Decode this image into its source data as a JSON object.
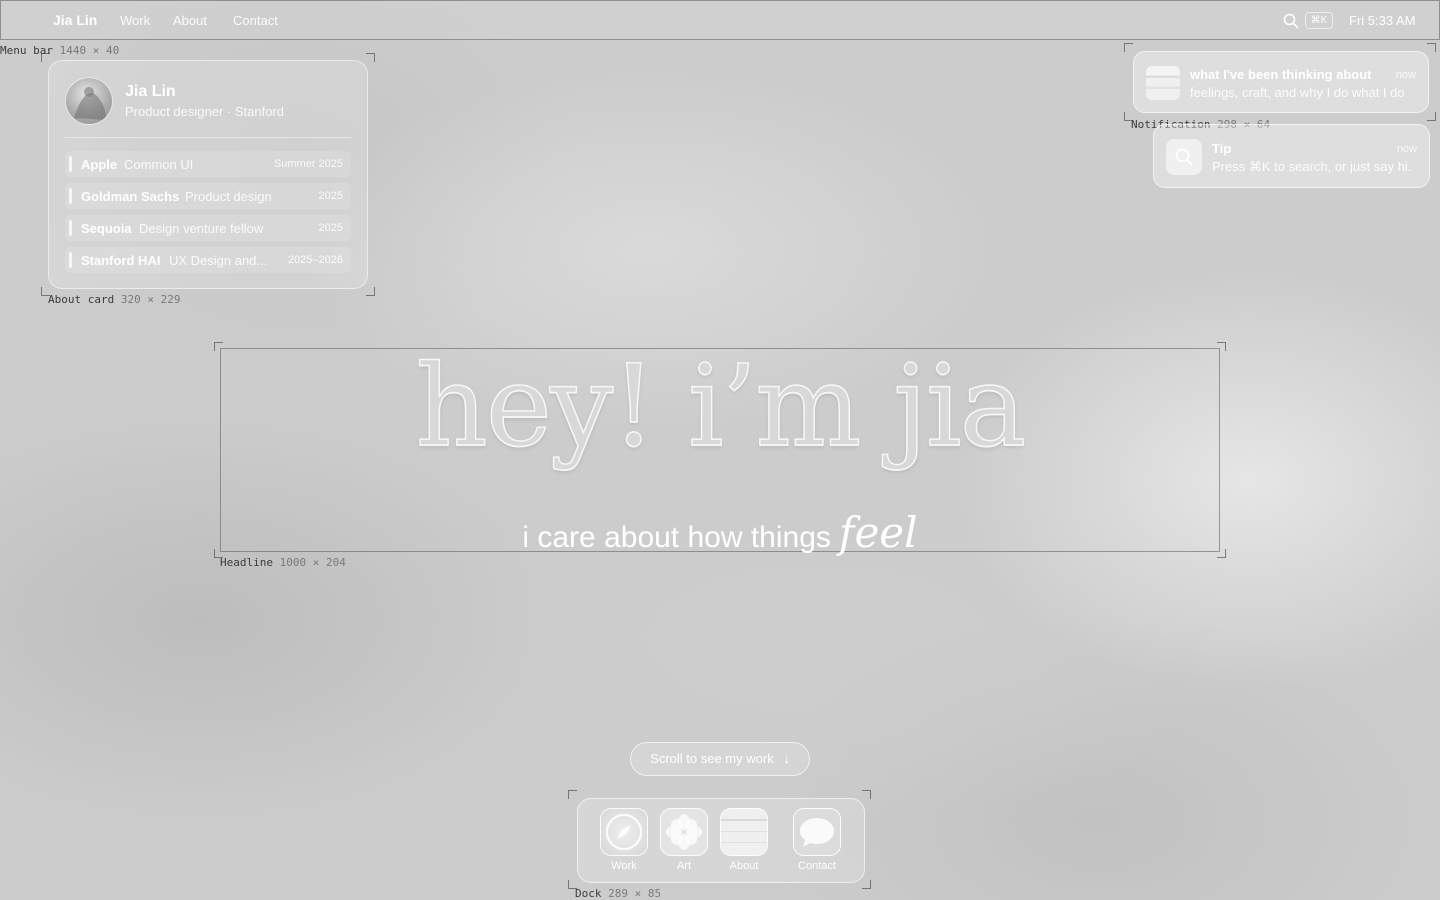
{
  "menubar": {
    "brand": "Jia Lin",
    "nav": [
      "Work",
      "About",
      "Contact"
    ],
    "shortcut": "⌘K",
    "clock": "Fri 5:33 AM"
  },
  "about_card": {
    "name": "Jia Lin",
    "role": "Product designer · Stanford",
    "experience": [
      {
        "company": "Apple",
        "title": "Common UI",
        "years": "Summer 2025"
      },
      {
        "company": "Goldman Sachs",
        "title": "Product design",
        "years": "2025"
      },
      {
        "company": "Sequoia",
        "title": "Design venture fellow",
        "years": "2025"
      },
      {
        "company": "Stanford HAI",
        "title": "UX Design and...",
        "years": "2025–2026"
      }
    ]
  },
  "notifications": [
    {
      "title": "what I've been thinking about",
      "body": "feelings, craft, and why I do what I do",
      "time": "now"
    },
    {
      "title": "Tip",
      "body": "Press ⌘K to search, or just say hi.",
      "time": "now"
    }
  ],
  "headline": {
    "title": "hey! i’m jia",
    "subtitle": "i care about how things",
    "emphasis": "feel"
  },
  "scroll_cta": "Scroll to see my work",
  "dock": [
    {
      "label": "Work",
      "icon": "compass-icon"
    },
    {
      "label": "Art",
      "icon": "flower-icon"
    },
    {
      "label": "About",
      "icon": "notes-icon"
    },
    {
      "label": "Contact",
      "icon": "message-bubble-icon"
    }
  ],
  "annotations": {
    "menubar": {
      "name": "Menu bar",
      "dims": "1440 × 40"
    },
    "about_card": {
      "name": "About card",
      "dims": "320 × 229"
    },
    "notification": {
      "name": "Notification",
      "dims": "298 × 64"
    },
    "headline": {
      "name": "Headline",
      "dims": "1000 × 204"
    },
    "dock": {
      "name": "Dock",
      "dims": "289 × 85"
    }
  }
}
